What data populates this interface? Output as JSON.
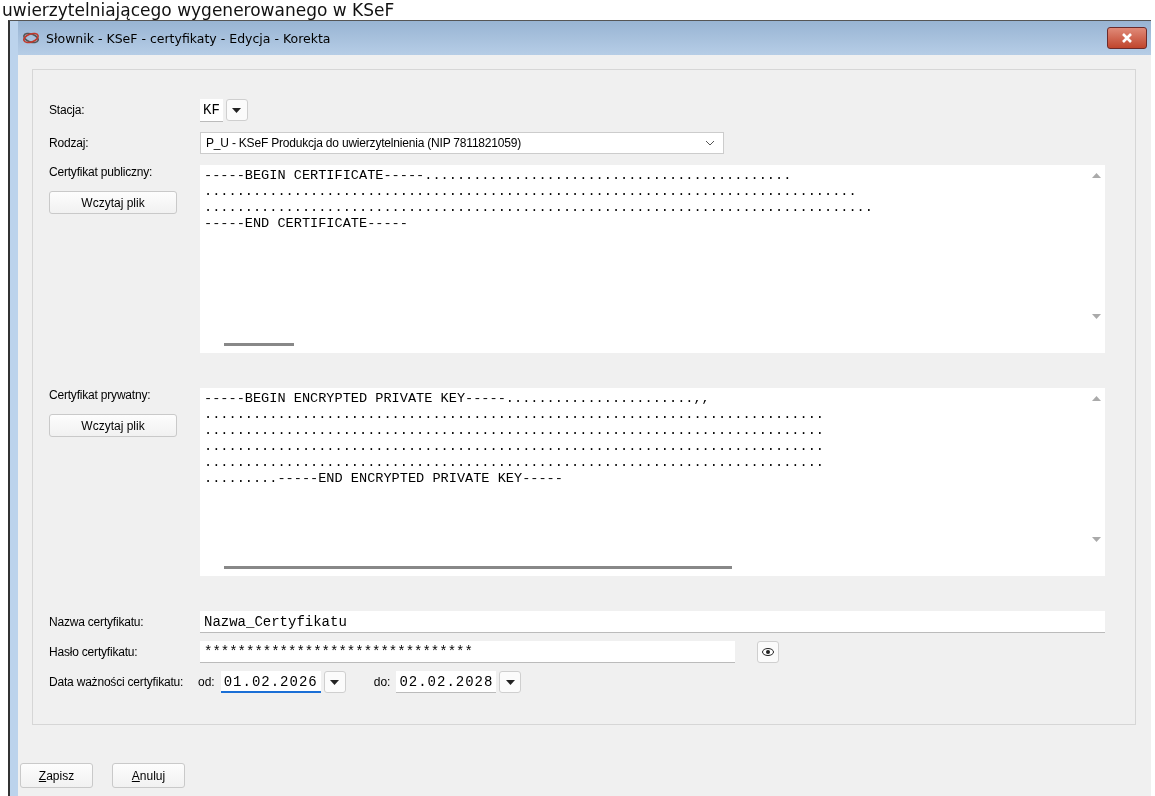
{
  "heading_fragment": "uwierzytelniającego wygenerowanego w KSeF",
  "window": {
    "title": "Słownik - KSeF - certyfikaty - Edycja - Korekta"
  },
  "station": {
    "label": "Stacja:",
    "value": "KF"
  },
  "kind": {
    "label": "Rodzaj:",
    "value": "P_U - KSeF Produkcja do uwierzytelnienia (NIP 7811821059)"
  },
  "public_cert": {
    "label": "Certyfikat publiczny:",
    "button": "Wczytaj plik",
    "lines": [
      "-----BEGIN CERTIFICATE-----.............................................",
      "................................................................................",
      "..................................................................................",
      "-----END CERTIFICATE-----"
    ]
  },
  "private_cert": {
    "label": "Certyfikat prywatny:",
    "button": "Wczytaj plik",
    "lines": [
      "-----BEGIN ENCRYPTED PRIVATE KEY-----.......................,,",
      "............................................................................",
      "............................................................................",
      "............................................................................",
      "............................................................................",
      ".........-----END ENCRYPTED PRIVATE KEY-----"
    ]
  },
  "cert_name": {
    "label": "Nazwa certyfikatu:",
    "value": "Nazwa_Certyfikatu"
  },
  "password": {
    "label": "Hasło certyfikatu:",
    "value": "********************************"
  },
  "validity": {
    "label": "Data ważności certyfikatu:",
    "from": {
      "label": "od:",
      "value": "01.02.2026",
      "focused": true
    },
    "to": {
      "label": "do:",
      "value": "02.02.2028",
      "focused": false
    }
  },
  "buttons": [
    {
      "label": "Zapisz",
      "first_letter_underlined": true
    },
    {
      "label": "Anuluj",
      "first_letter_underlined": true
    }
  ]
}
